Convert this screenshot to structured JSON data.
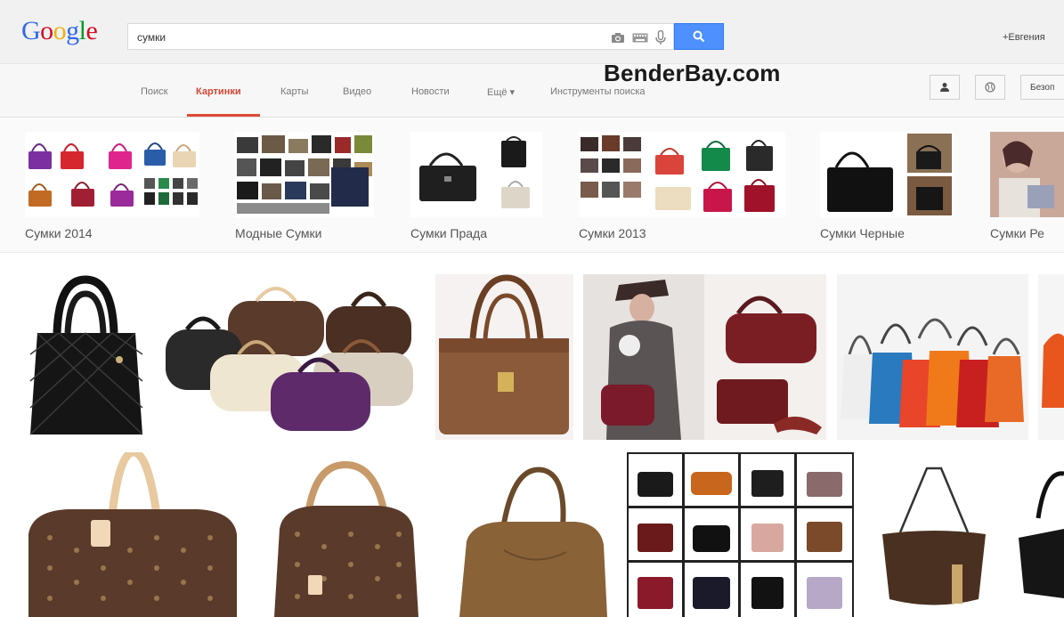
{
  "header": {
    "logo": {
      "letters": [
        "G",
        "o",
        "o",
        "g",
        "l",
        "e"
      ],
      "colors": [
        "#3369e8",
        "#d50f25",
        "#eeb211",
        "#3369e8",
        "#009925",
        "#d50f25"
      ]
    },
    "search": {
      "query": "сумки"
    },
    "icons": [
      "camera-icon",
      "keyboard-icon",
      "microphone-icon",
      "search-icon"
    ],
    "user_link": "+Евгения"
  },
  "tabs": [
    {
      "label": "Поиск",
      "active": false
    },
    {
      "label": "Картинки",
      "active": true
    },
    {
      "label": "Карты",
      "active": false
    },
    {
      "label": "Видео",
      "active": false
    },
    {
      "label": "Новости",
      "active": false
    },
    {
      "label": "Ещё ▾",
      "active": false
    },
    {
      "label": "Инструменты поиска",
      "active": false
    }
  ],
  "watermark": "BenderBay.com",
  "toolbar": {
    "safe_search_label": "Безоп"
  },
  "related": [
    {
      "label": "Сумки 2014"
    },
    {
      "label": "Модные Сумки"
    },
    {
      "label": "Сумки Прада"
    },
    {
      "label": "Сумки 2013"
    },
    {
      "label": "Сумки Черные"
    },
    {
      "label": "Сумки Ре"
    }
  ],
  "colors": {
    "accent_red": "#dd4b39",
    "search_blue": "#4d90fe",
    "monogram_brown": "#5a3a2a",
    "tan": "#e8c9a0"
  }
}
